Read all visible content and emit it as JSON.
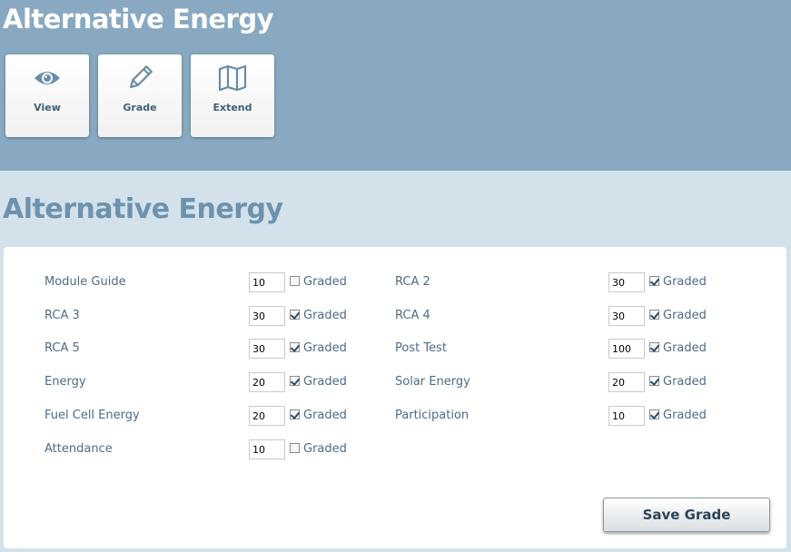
{
  "header": {
    "title": "Alternative Energy",
    "tiles": [
      {
        "label": "View",
        "icon": "eye-icon"
      },
      {
        "label": "Grade",
        "icon": "pencil-icon"
      },
      {
        "label": "Extend",
        "icon": "map-icon"
      }
    ]
  },
  "main": {
    "heading": "Alternative Energy",
    "graded_label": "Graded",
    "items": [
      {
        "name": "Module Guide",
        "points": "10",
        "graded": false
      },
      {
        "name": "RCA 2",
        "points": "30",
        "graded": true
      },
      {
        "name": "RCA 3",
        "points": "30",
        "graded": true
      },
      {
        "name": "RCA 4",
        "points": "30",
        "graded": true
      },
      {
        "name": "RCA 5",
        "points": "30",
        "graded": true
      },
      {
        "name": "Post Test",
        "points": "100",
        "graded": true
      },
      {
        "name": "Energy",
        "points": "20",
        "graded": true
      },
      {
        "name": "Solar Energy",
        "points": "20",
        "graded": true
      },
      {
        "name": "Fuel Cell Energy",
        "points": "20",
        "graded": true
      },
      {
        "name": "Participation",
        "points": "10",
        "graded": true
      },
      {
        "name": "Attendance",
        "points": "10",
        "graded": false
      }
    ],
    "save_label": "Save Grade"
  },
  "colors": {
    "header_bg": "#88a9c1",
    "page_bg": "#d3e1ea",
    "heading_text": "#6d92ad",
    "tile_text": "#3f5f78",
    "label_text": "#4d6b86"
  }
}
